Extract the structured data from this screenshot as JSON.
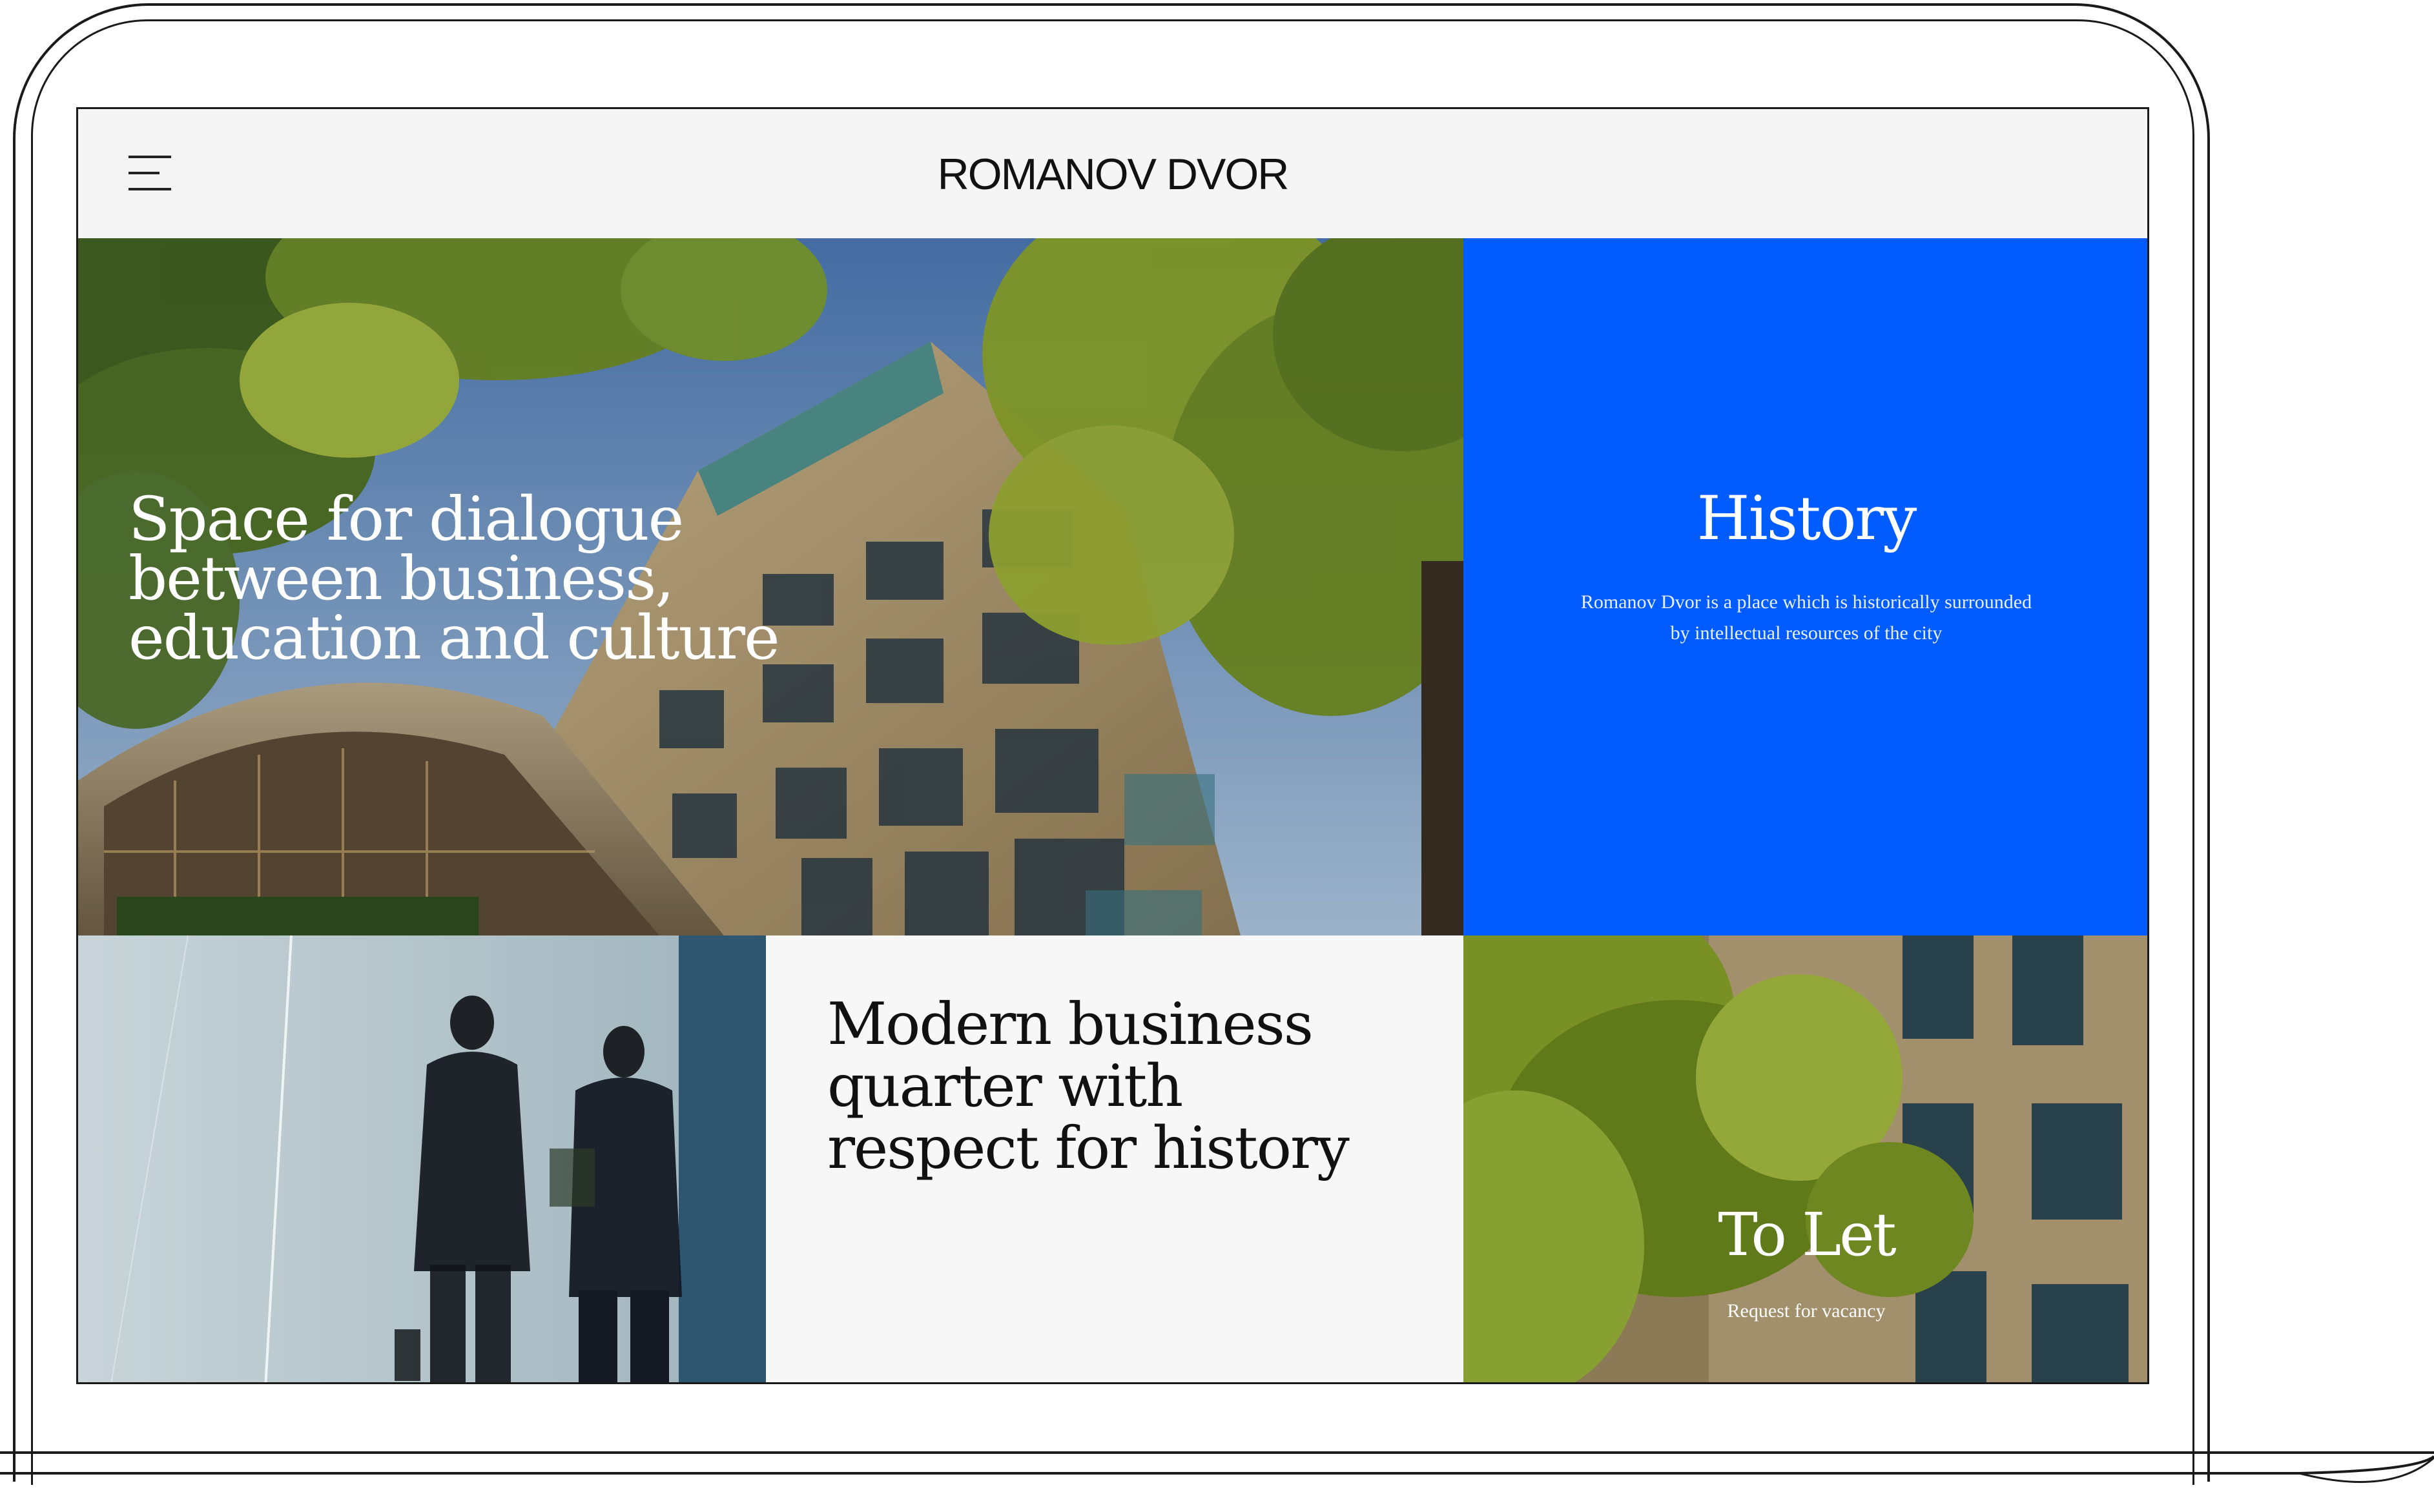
{
  "header": {
    "logo": "ROMANOV DVOR",
    "menu_icon": "hamburger-menu-icon"
  },
  "hero": {
    "title": "Space for dialogue between business, education and culture"
  },
  "history": {
    "title": "History",
    "text": "Romanov Dvor is a place which is historically surrounded by intellectual resources of the city"
  },
  "modern": {
    "title": "Modern business quarter with respect for history"
  },
  "tolet": {
    "title": "To Let",
    "link": "Request for vacancy"
  },
  "colors": {
    "accent_blue": "#005cff",
    "header_bg": "#f5f5f5",
    "text_dark": "#111111"
  }
}
